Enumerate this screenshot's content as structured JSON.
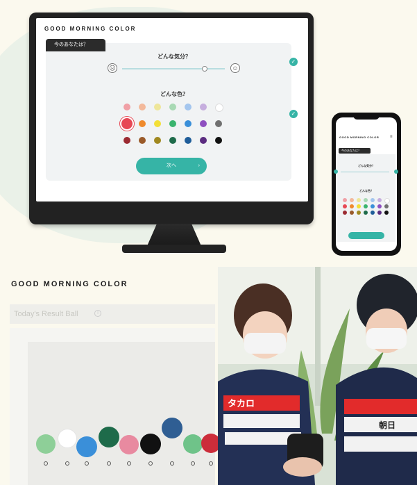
{
  "desktop": {
    "brand": "GOOD MORNING COLOR",
    "tab_label": "今のあなたは？",
    "question_mood": "どんな気分？",
    "question_color": "どんな色？",
    "button_label": "次へ",
    "palette_rows": [
      [
        "#f0a0a6",
        "#f3b99b",
        "#eee69a",
        "#a8d9b4",
        "#a4c6ee",
        "#c6aede",
        "#ffffff"
      ],
      [
        "#e74855",
        "#ef8a2c",
        "#f3df37",
        "#3ab46e",
        "#3a8fd9",
        "#8e4fc0",
        "#707070"
      ],
      [
        "#9b2a32",
        "#9a5a2a",
        "#a08820",
        "#1e6b4a",
        "#1f5d99",
        "#5b2c80",
        "#111111"
      ]
    ]
  },
  "phone": {
    "brand": "GOOD MORNING COLOR",
    "tab_label": "今のあなたは？",
    "question_mood": "どんな気分？",
    "question_color": "どんな色？"
  },
  "dashboard": {
    "brand": "GOOD MORNING COLOR",
    "header": "Today's Result Ball",
    "balls": [
      {
        "color": "#8ecf98"
      },
      {
        "color": "#ffffff"
      },
      {
        "color": "#3a8fd9"
      },
      {
        "color": "#1e6b4a"
      },
      {
        "color": "#e88aa0"
      },
      {
        "color": "#111111"
      },
      {
        "color": "#2f5e93"
      },
      {
        "color": "#6fc389"
      },
      {
        "color": "#cc2d3a"
      }
    ]
  },
  "photo": {
    "jersey_text_1": "タカロ",
    "jersey_text_2": "朝日"
  }
}
